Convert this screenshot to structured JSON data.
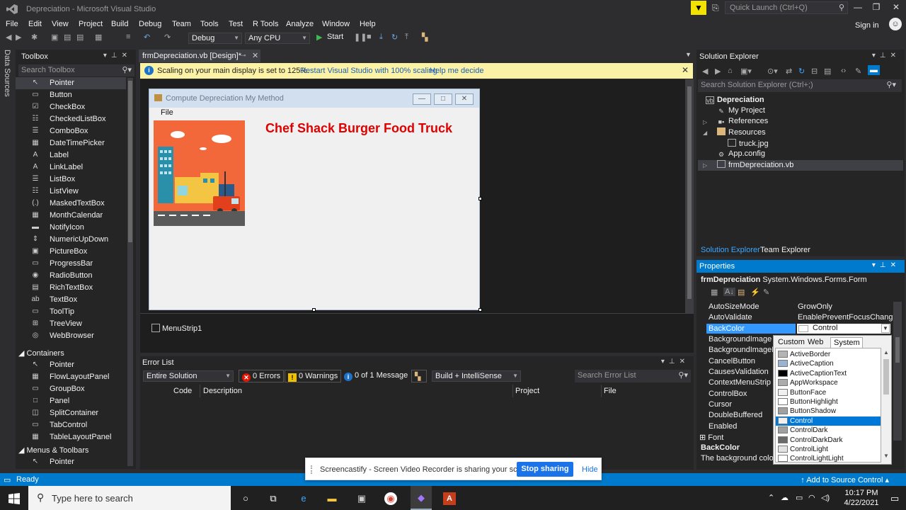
{
  "window": {
    "title": "Depreciation - Microsoft Visual Studio"
  },
  "quick_launch": {
    "placeholder": "Quick Launch (Ctrl+Q)"
  },
  "menu": [
    "File",
    "Edit",
    "View",
    "Project",
    "Build",
    "Debug",
    "Team",
    "Tools",
    "Test",
    "R Tools",
    "Analyze",
    "Window",
    "Help"
  ],
  "signin": "Sign in",
  "toolbar": {
    "config": "Debug",
    "platform": "Any CPU",
    "start": "Start"
  },
  "side_strip": "Data Sources",
  "toolbox": {
    "title": "Toolbox",
    "search_placeholder": "Search Toolbox",
    "items": [
      "Pointer",
      "Button",
      "CheckBox",
      "CheckedListBox",
      "ComboBox",
      "DateTimePicker",
      "Label",
      "LinkLabel",
      "ListBox",
      "ListView",
      "MaskedTextBox",
      "MonthCalendar",
      "NotifyIcon",
      "NumericUpDown",
      "PictureBox",
      "ProgressBar",
      "RadioButton",
      "RichTextBox",
      "TextBox",
      "ToolTip",
      "TreeView",
      "WebBrowser"
    ],
    "group_containers": "Containers",
    "containers": [
      "Pointer",
      "FlowLayoutPanel",
      "GroupBox",
      "Panel",
      "SplitContainer",
      "TabControl",
      "TableLayoutPanel"
    ],
    "group_menus": "Menus & Toolbars",
    "menus": [
      "Pointer"
    ]
  },
  "doc_tab": "frmDepreciation.vb [Design]*",
  "infobar": {
    "message": "Scaling on your main display is set to 125%.",
    "link1": "Restart Visual Studio with 100% scaling",
    "link2": "Help me decide"
  },
  "form": {
    "title": "Compute Depreciation My Method",
    "menu_file": "File",
    "heading": "Chef Shack Burger Food Truck"
  },
  "tray_component": "MenuStrip1",
  "error_list": {
    "title": "Error List",
    "scope": "Entire Solution",
    "errors": "0 Errors",
    "warnings": "0 Warnings",
    "messages": "0 of 1 Message",
    "build_filter": "Build + IntelliSense",
    "search_placeholder": "Search Error List",
    "columns": {
      "code": "Code",
      "description": "Description",
      "project": "Project",
      "file": "File"
    }
  },
  "solution_explorer": {
    "title": "Solution Explorer",
    "search_placeholder": "Search Solution Explorer (Ctrl+;)",
    "items": [
      "Depreciation",
      "My Project",
      "References",
      "Resources",
      "truck.jpg",
      "App.config",
      "frmDepreciation.vb"
    ],
    "tab_solution": "Solution Explorer",
    "tab_team": "Team Explorer"
  },
  "properties": {
    "title": "Properties",
    "object_name": "frmDepreciation",
    "object_type": "System.Windows.Forms.Form",
    "rows": [
      {
        "name": "AutoSizeMode",
        "value": "GrowOnly"
      },
      {
        "name": "AutoValidate",
        "value": "EnablePreventFocusChange"
      },
      {
        "name": "BackColor",
        "value": "Control"
      },
      {
        "name": "BackgroundImage",
        "value": ""
      },
      {
        "name": "BackgroundImageLa",
        "value": ""
      },
      {
        "name": "CancelButton",
        "value": ""
      },
      {
        "name": "CausesValidation",
        "value": ""
      },
      {
        "name": "ContextMenuStrip",
        "value": ""
      },
      {
        "name": "ControlBox",
        "value": ""
      },
      {
        "name": "Cursor",
        "value": ""
      },
      {
        "name": "DoubleBuffered",
        "value": ""
      },
      {
        "name": "Enabled",
        "value": ""
      },
      {
        "name": "Font",
        "value": ""
      }
    ],
    "desc_title": "BackColor",
    "desc_text": "The background color"
  },
  "color_popup": {
    "tabs": [
      "Custom",
      "Web",
      "System"
    ],
    "active_tab": "System",
    "items": [
      {
        "name": "ActiveBorder",
        "color": "#b4b4b4"
      },
      {
        "name": "ActiveCaption",
        "color": "#99b4d1"
      },
      {
        "name": "ActiveCaptionText",
        "color": "#000000"
      },
      {
        "name": "AppWorkspace",
        "color": "#ababab"
      },
      {
        "name": "ButtonFace",
        "color": "#f0f0f0"
      },
      {
        "name": "ButtonHighlight",
        "color": "#ffffff"
      },
      {
        "name": "ButtonShadow",
        "color": "#a0a0a0"
      },
      {
        "name": "Control",
        "color": "#f0f0f0"
      },
      {
        "name": "ControlDark",
        "color": "#a0a0a0"
      },
      {
        "name": "ControlDarkDark",
        "color": "#696969"
      },
      {
        "name": "ControlLight",
        "color": "#e3e3e3"
      },
      {
        "name": "ControlLightLight",
        "color": "#ffffff"
      }
    ],
    "selected": "Control"
  },
  "status": {
    "ready": "Ready",
    "source_control": "Add to Source Control"
  },
  "screencastify": {
    "message": "Screencastify - Screen Video Recorder is sharing your screen.",
    "stop": "Stop sharing",
    "hide": "Hide"
  },
  "taskbar": {
    "search_placeholder": "Type here to search",
    "time": "10:17 PM",
    "date": "4/22/2021"
  },
  "colors": {
    "accent": "#007acc",
    "ide_bg": "#2d2d30",
    "panel_bg": "#252526",
    "heading_red": "#e00000",
    "info_yellow": "#fcf2a5"
  }
}
